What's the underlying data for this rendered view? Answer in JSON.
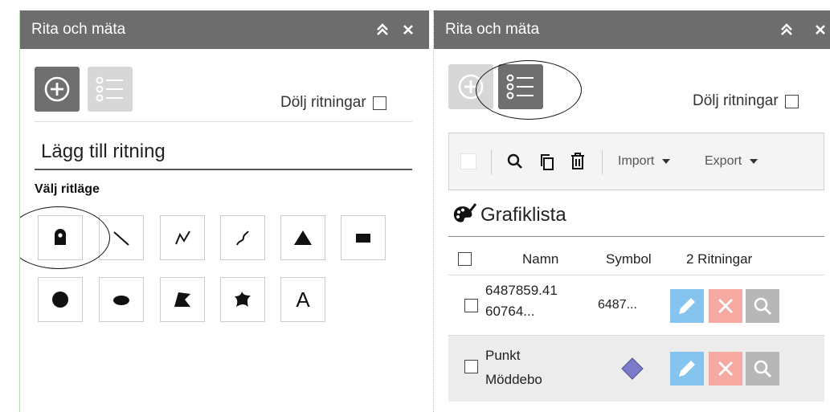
{
  "left_panel": {
    "title": "Rita och mäta",
    "hide_drawings_label": "Dölj ritningar",
    "add_drawing_title": "Lägg till ritning",
    "draw_mode_label": "Välj ritläge",
    "tools": [
      {
        "icon": "point-marker-icon"
      },
      {
        "icon": "line-icon"
      },
      {
        "icon": "polyline-icon"
      },
      {
        "icon": "freehand-line-icon"
      },
      {
        "icon": "triangle-icon"
      },
      {
        "icon": "rectangle-icon"
      },
      {
        "icon": "circle-icon"
      },
      {
        "icon": "ellipse-icon"
      },
      {
        "icon": "polygon-icon"
      },
      {
        "icon": "freehand-polygon-icon"
      },
      {
        "icon": "text-icon",
        "glyph": "A"
      }
    ]
  },
  "right_panel": {
    "title": "Rita och mäta",
    "hide_drawings_label": "Dölj ritningar",
    "toolbar": {
      "import_label": "Import",
      "export_label": "Export"
    },
    "list_title": "Grafiklista",
    "columns": {
      "name": "Namn",
      "symbol": "Symbol",
      "count": "2 Ritningar"
    },
    "rows": [
      {
        "name_line1": "6487859.41",
        "name_line2": "60764...",
        "symbol_text": "6487...",
        "symbol_icon": "",
        "highlighted": false
      },
      {
        "name_line1": "Punkt",
        "name_line2": "Möddebo",
        "symbol_text": "",
        "symbol_icon": "diamond-icon",
        "symbol_color": "#7b7bc8",
        "highlighted": true
      }
    ]
  },
  "colors": {
    "titlebar": "#6d6d6d",
    "edit": "#85c4ef",
    "delete": "#f6a9a0",
    "zoom": "#b7b7b7",
    "row_highlight": "#ececec"
  }
}
